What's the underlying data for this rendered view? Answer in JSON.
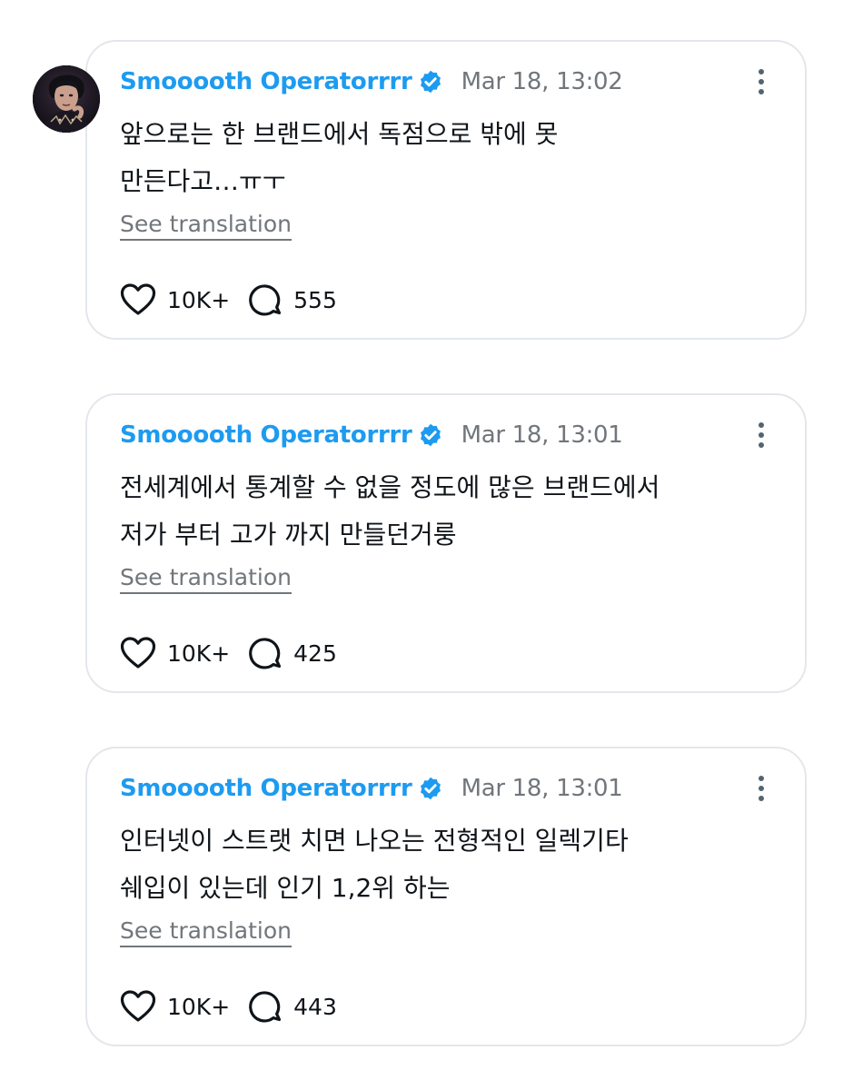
{
  "replies": [
    {
      "author": "Smooooth Operatorrrr",
      "timestamp": "Mar 18, 13:02",
      "text": "앞으로는 한 브랜드에서 독점으로 밖에 못\n만든다고…ㅠㅜ",
      "translate_label": "See translation",
      "likes": "10K+",
      "comments": "555"
    },
    {
      "author": "Smooooth Operatorrrr",
      "timestamp": "Mar 18, 13:01",
      "text": "전세계에서 통계할 수 없을 정도에 많은 브랜드에서\n저가 부터 고가 까지 만들던거룽",
      "translate_label": "See translation",
      "likes": "10K+",
      "comments": "425"
    },
    {
      "author": "Smooooth Operatorrrr",
      "timestamp": "Mar 18, 13:01",
      "text": "인터넷이 스트랫 치면 나오는 전형적인 일렉기타\n쉐입이 있는데 인기 1,2위 하는",
      "translate_label": "See translation",
      "likes": "10K+",
      "comments": "443"
    }
  ],
  "icons": {
    "verified": "verified-badge-icon",
    "more": "more-options-icon",
    "like": "heart-icon",
    "comment": "comment-bubble-icon"
  },
  "colors": {
    "author": "#1d9bf0",
    "verified": "#1d9bf0",
    "muted": "#71767b",
    "text": "#0f1419",
    "border": "#e3e7ec"
  }
}
